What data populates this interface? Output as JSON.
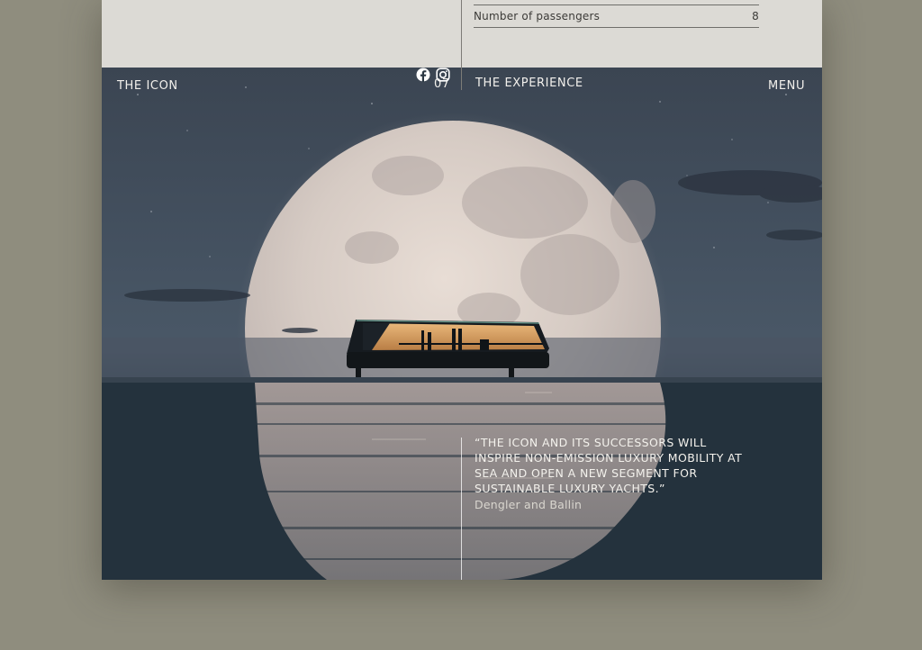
{
  "specs": {
    "passengers_label": "Number of passengers",
    "passengers_value": "8"
  },
  "header": {
    "section_title": "THE ICON",
    "page_number": "07",
    "section_subtitle": "THE EXPERIENCE",
    "menu_label": "MENU"
  },
  "quote": {
    "text": "“THE ICON AND ITS SUCCESSORS WILL INSPIRE NON-EMISSION LUXURY MOBILITY AT SEA AND OPEN A NEW SEGMENT FOR SUSTAINABLE LUXURY YACHTS.”",
    "author": "Dengler and Ballin"
  },
  "social": {
    "icons": [
      "facebook-icon",
      "instagram-icon"
    ]
  },
  "colors": {
    "page_background": "#8f8d7e",
    "panel": "#dcdad5",
    "text_light": "#f2f0ec"
  }
}
